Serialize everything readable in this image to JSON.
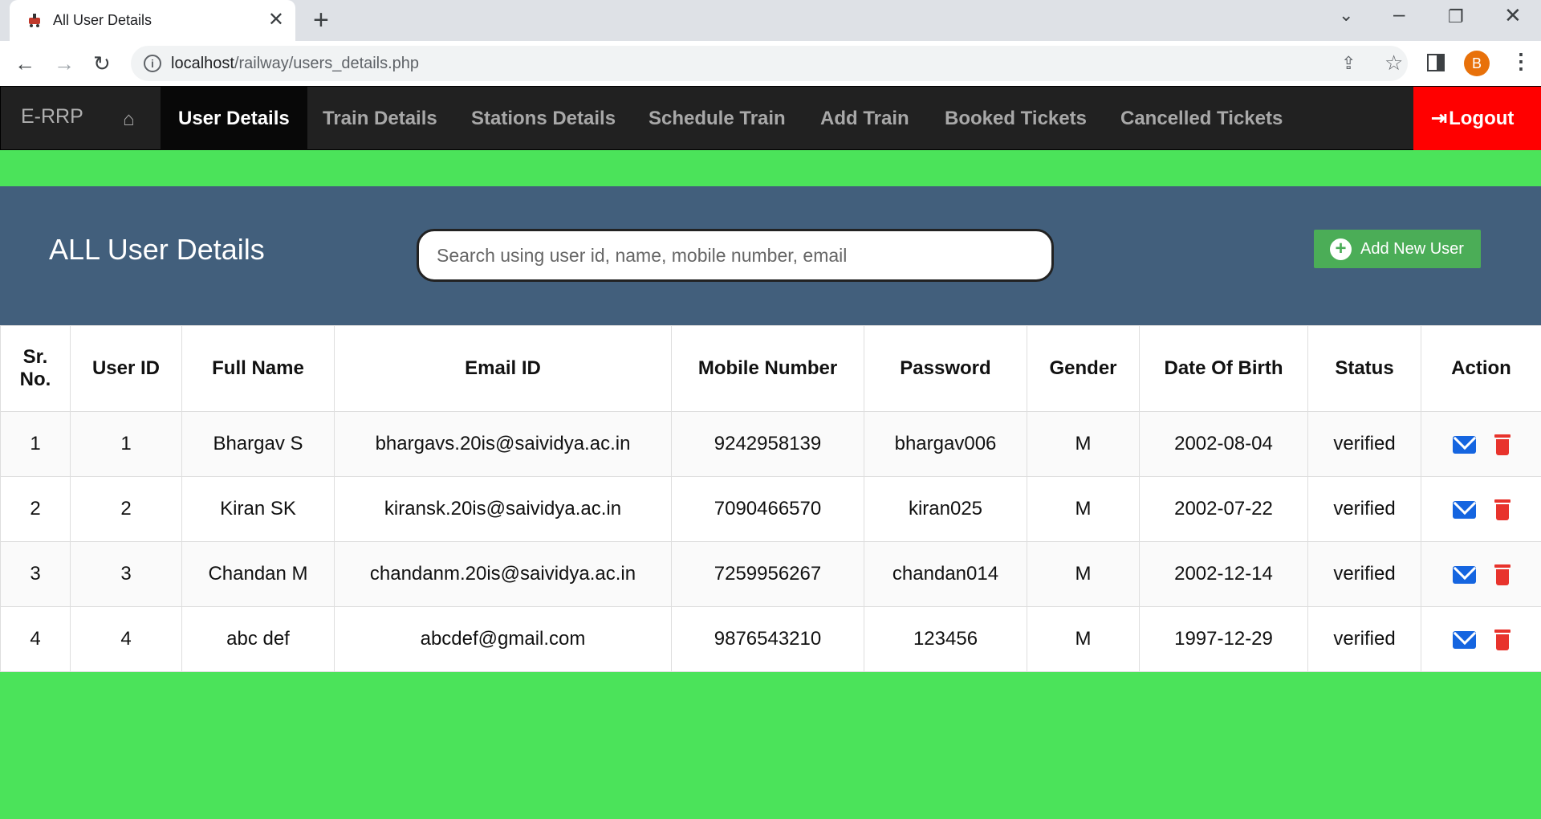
{
  "browser": {
    "tab_title": "All User Details",
    "new_tab_glyph": "+",
    "close_glyph": "✕",
    "url_host": "localhost",
    "url_path": "/railway/users_details.php",
    "avatar_letter": "B"
  },
  "navbar": {
    "brand": "E-RRP",
    "items": [
      {
        "label": "User Details",
        "active": true
      },
      {
        "label": "Train Details"
      },
      {
        "label": "Stations Details"
      },
      {
        "label": "Schedule Train"
      },
      {
        "label": "Add Train"
      },
      {
        "label": "Booked Tickets"
      },
      {
        "label": "Cancelled Tickets"
      }
    ],
    "logout_label": "Logout"
  },
  "header": {
    "title": "ALL User Details",
    "search_placeholder": "Search using user id, name, mobile number, email",
    "add_button_label": "Add New User"
  },
  "table": {
    "columns": [
      "Sr. No.",
      "User ID",
      "Full Name",
      "Email ID",
      "Mobile Number",
      "Password",
      "Gender",
      "Date Of Birth",
      "Status",
      "Action"
    ],
    "rows": [
      [
        "1",
        "1",
        "Bhargav S",
        "bhargavs.20is@saividya.ac.in",
        "9242958139",
        "bhargav006",
        "M",
        "2002-08-04",
        "verified"
      ],
      [
        "2",
        "2",
        "Kiran SK",
        "kiransk.20is@saividya.ac.in",
        "7090466570",
        "kiran025",
        "M",
        "2002-07-22",
        "verified"
      ],
      [
        "3",
        "3",
        "Chandan M",
        "chandanm.20is@saividya.ac.in",
        "7259956267",
        "chandan014",
        "M",
        "2002-12-14",
        "verified"
      ],
      [
        "4",
        "4",
        "abc def",
        "abcdef@gmail.com",
        "9876543210",
        "123456",
        "M",
        "1997-12-29",
        "verified"
      ]
    ]
  },
  "colors": {
    "page_bg": "#4be35a",
    "navbar_bg": "#212121",
    "header_bg": "#425f7c",
    "logout_bg": "#ff0000",
    "add_button_bg": "#4bad57",
    "mail_icon": "#1565e0",
    "trash_icon": "#e8332c"
  },
  "icons": [
    "home-icon",
    "logout-icon",
    "add-circle-icon",
    "mail-icon",
    "trash-icon"
  ]
}
